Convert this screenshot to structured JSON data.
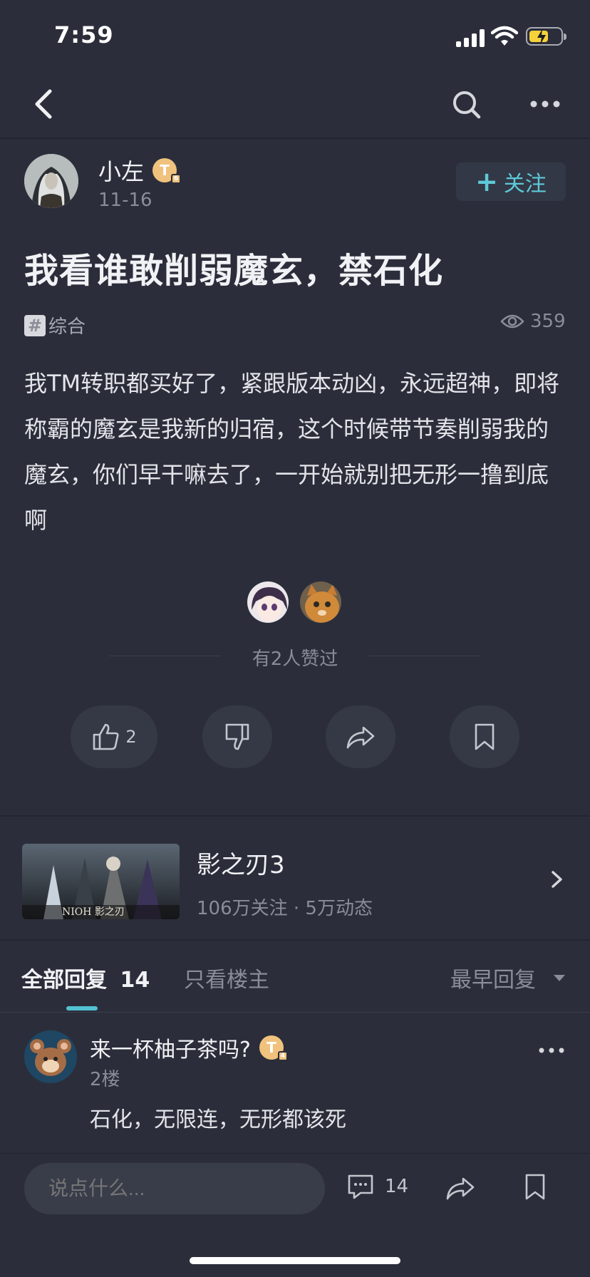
{
  "status_bar": {
    "time": "7:59"
  },
  "author": {
    "name": "小左",
    "level_badge": "T",
    "level_sub": "6",
    "date": "11-16",
    "follow_label": "关注",
    "follow_prefix": "+"
  },
  "post": {
    "title": "我看谁敢削弱魔玄，禁石化",
    "tag": "综合",
    "tag_icon": "#",
    "views": "359",
    "body": "我TM转职都买好了，紧跟版本动凶，永远超神，即将称霸的魔玄是我新的归宿，这个时候带节奏削弱我的魔玄，你们早干嘛去了，一开始就别把无形一撸到底啊"
  },
  "likers": {
    "text": "有2人赞过"
  },
  "actions": {
    "like_count": "2"
  },
  "game": {
    "name": "影之刃3",
    "stats": "106万关注 · 5万动态",
    "thumb_logo_text": "NIOH 影之刃"
  },
  "tabs": {
    "all_label": "全部回复",
    "all_count": "14",
    "host_only": "只看楼主",
    "sort": "最早回复"
  },
  "reply": {
    "name": "来一杯柚子茶吗?",
    "level_badge": "T",
    "level_sub": "4",
    "floor": "2楼",
    "text": "石化，无限连，无形都该死"
  },
  "bottom_bar": {
    "input_placeholder": "说点什么...",
    "comment_count": "14"
  },
  "colors": {
    "background": "#2b2e3a",
    "accent": "#52c2d3",
    "badge": "#f0c27d"
  }
}
